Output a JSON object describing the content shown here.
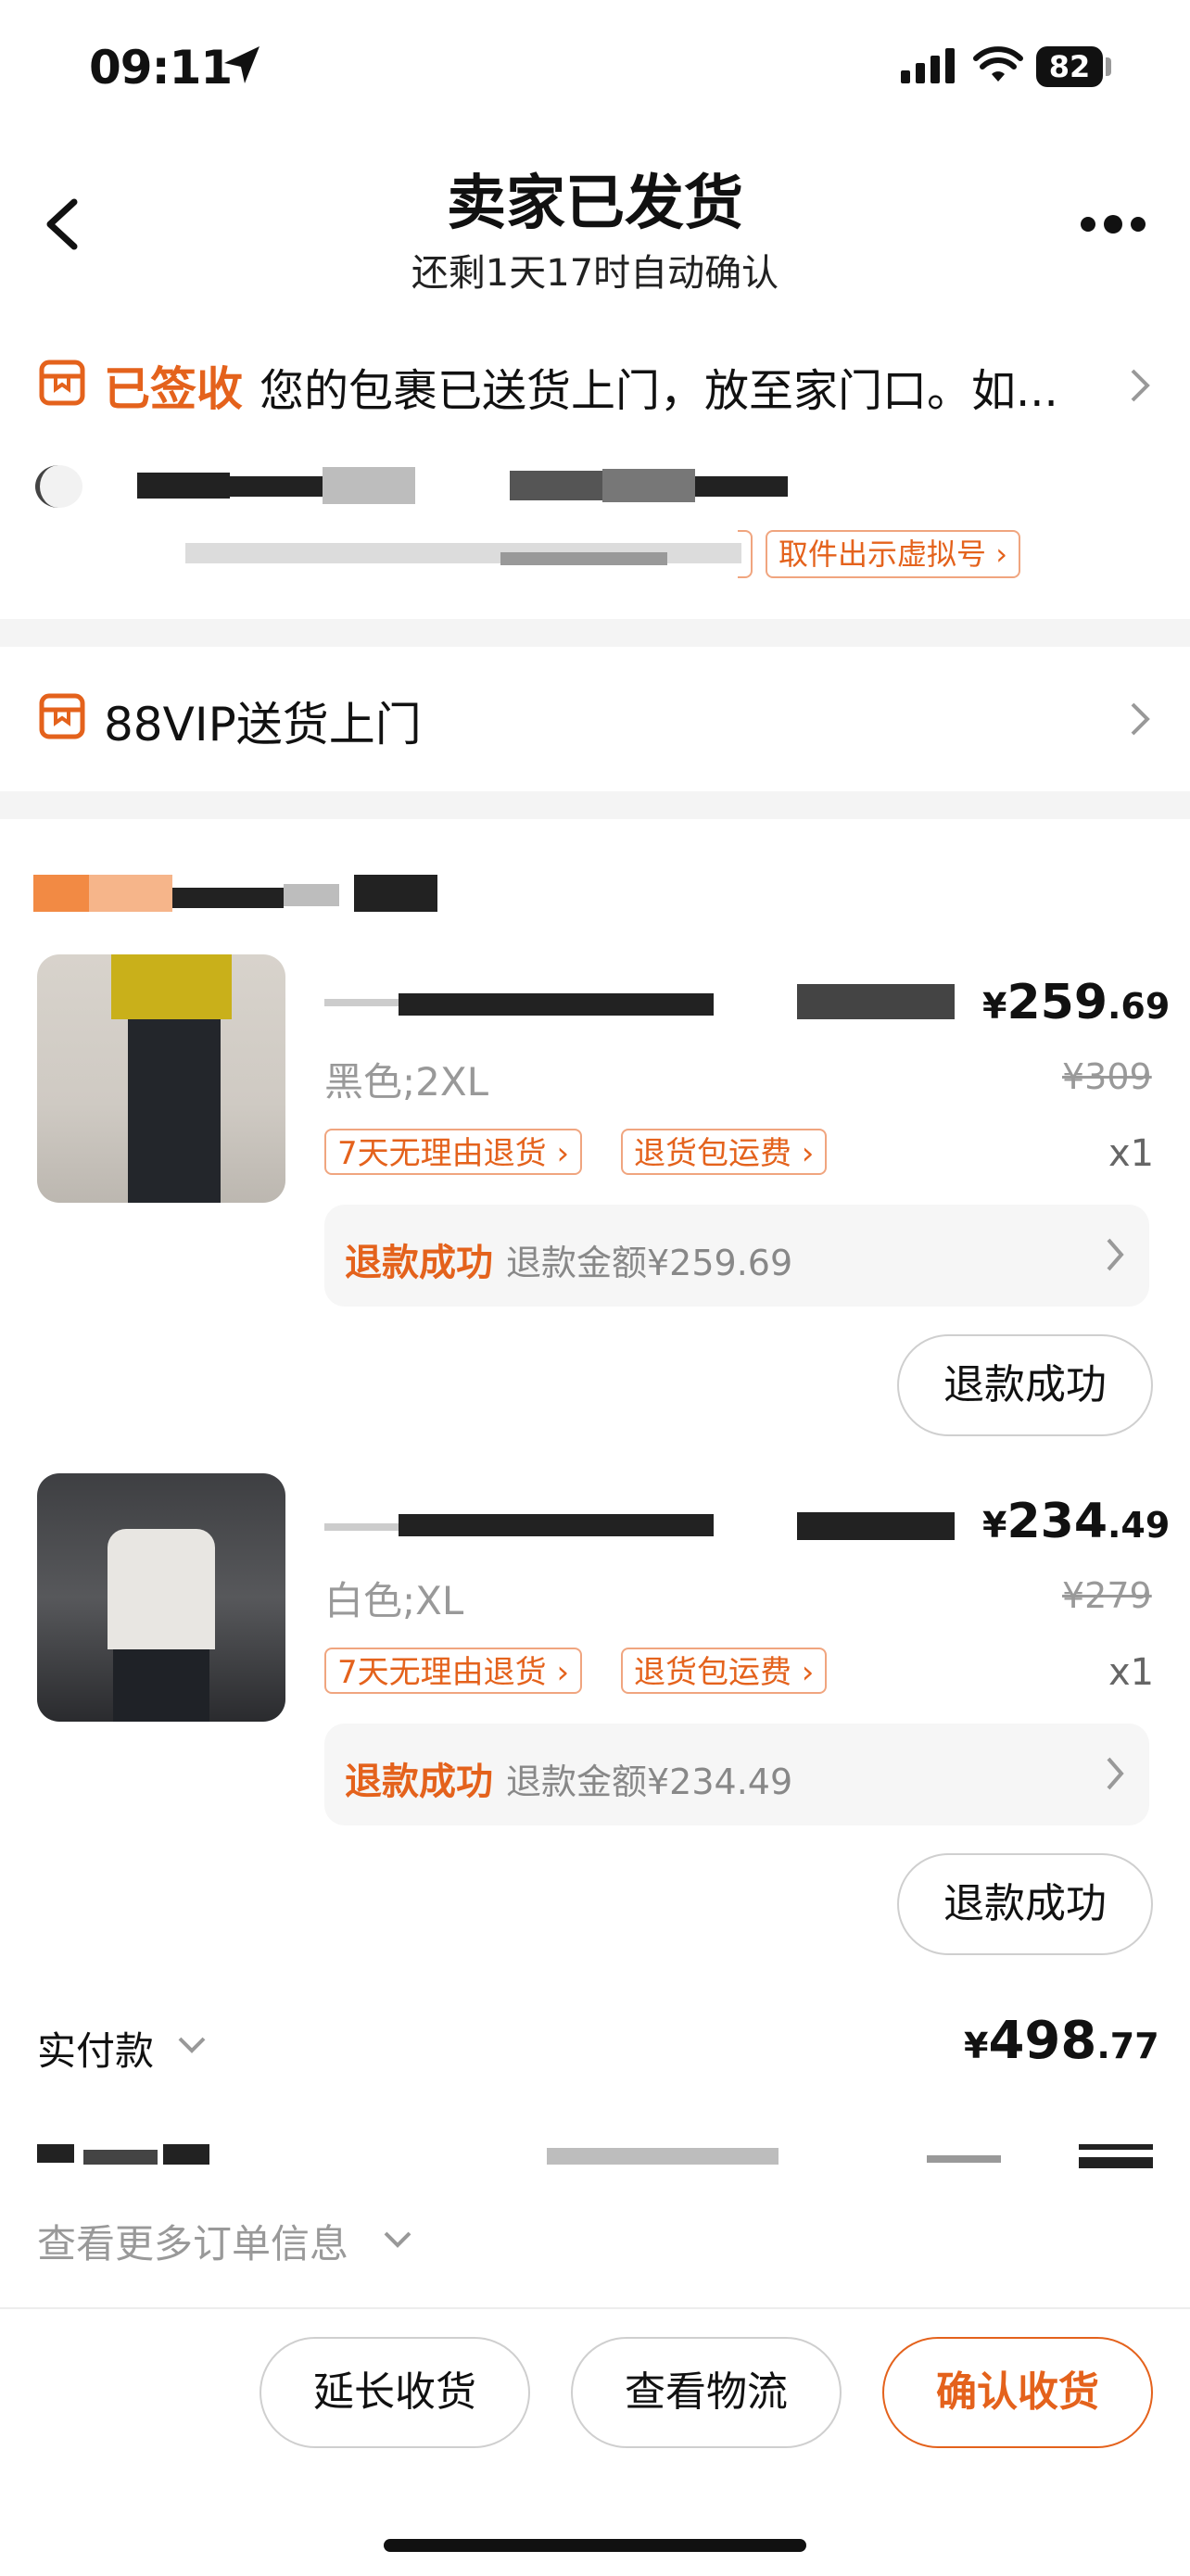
{
  "status_bar": {
    "time": "09:11",
    "battery": "82"
  },
  "header": {
    "title": "卖家已发货",
    "subtitle": "还剩1天17时自动确认"
  },
  "logistics": {
    "status": "已签收",
    "message": "您的包裹已送货上门，放至家门口。如..."
  },
  "address": {
    "virtual_number_button": "取件出示虚拟号"
  },
  "delivery_service": {
    "label": "88VIP送货上门"
  },
  "items": [
    {
      "spec": "黑色;2XL",
      "price_currency": "¥",
      "price_int": "259",
      "price_dec": ".69",
      "original_price": "¥309",
      "quantity": "x1",
      "tags": [
        "7天无理由退货",
        "退货包运费"
      ],
      "refund_status": "退款成功",
      "refund_amount": "退款金额¥259.69",
      "action_button": "退款成功"
    },
    {
      "spec": "白色;XL",
      "price_currency": "¥",
      "price_int": "234",
      "price_dec": ".49",
      "original_price": "¥279",
      "quantity": "x1",
      "tags": [
        "7天无理由退货",
        "退货包运费"
      ],
      "refund_status": "退款成功",
      "refund_amount": "退款金额¥234.49",
      "action_button": "退款成功"
    }
  ],
  "payment": {
    "label": "实付款",
    "currency": "¥",
    "amount_int": "498",
    "amount_dec": ".77"
  },
  "more_info": {
    "label": "查看更多订单信息"
  },
  "bottom_bar": {
    "extend_button": "延长收货",
    "logistics_button": "查看物流",
    "confirm_button": "确认收货"
  },
  "colors": {
    "accent": "#e4621c",
    "tag_border": "#f0a57f",
    "background_gap": "#f4f4f4"
  }
}
